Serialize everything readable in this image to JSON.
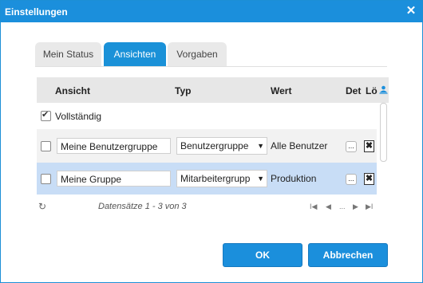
{
  "dialog": {
    "title": "Einstellungen",
    "close_label": "✕"
  },
  "tabs": [
    {
      "label": "Mein Status",
      "active": false
    },
    {
      "label": "Ansichten",
      "active": true
    },
    {
      "label": "Vorgaben",
      "active": false
    }
  ],
  "grid": {
    "columns": {
      "ansicht": "Ansicht",
      "typ": "Typ",
      "wert": "Wert",
      "det": "Det",
      "loe": "Lö"
    },
    "rows": [
      {
        "checked": true,
        "ansicht": "Vollständig",
        "typ": "",
        "wert": ""
      },
      {
        "checked": false,
        "ansicht": "Meine Benutzergruppe",
        "typ": "Benutzergruppe",
        "wert": "Alle Benutzer",
        "det_label": "...",
        "del_label": "✖"
      },
      {
        "checked": false,
        "ansicht": "Meine Gruppe",
        "typ": "Mitarbeitergrupp",
        "wert": "Produktion",
        "det_label": "...",
        "del_label": "✖",
        "selected": true
      }
    ],
    "footer": {
      "refresh_icon": "↻",
      "info": "Datensätze 1 - 3 von 3",
      "first": "I◀",
      "prev": "◀",
      "dots": "...",
      "next": "▶",
      "last": "▶I"
    }
  },
  "buttons": {
    "ok": "OK",
    "cancel": "Abbrechen"
  },
  "colors": {
    "accent": "#1b8fdc",
    "selected_row": "#c8ddf6"
  }
}
